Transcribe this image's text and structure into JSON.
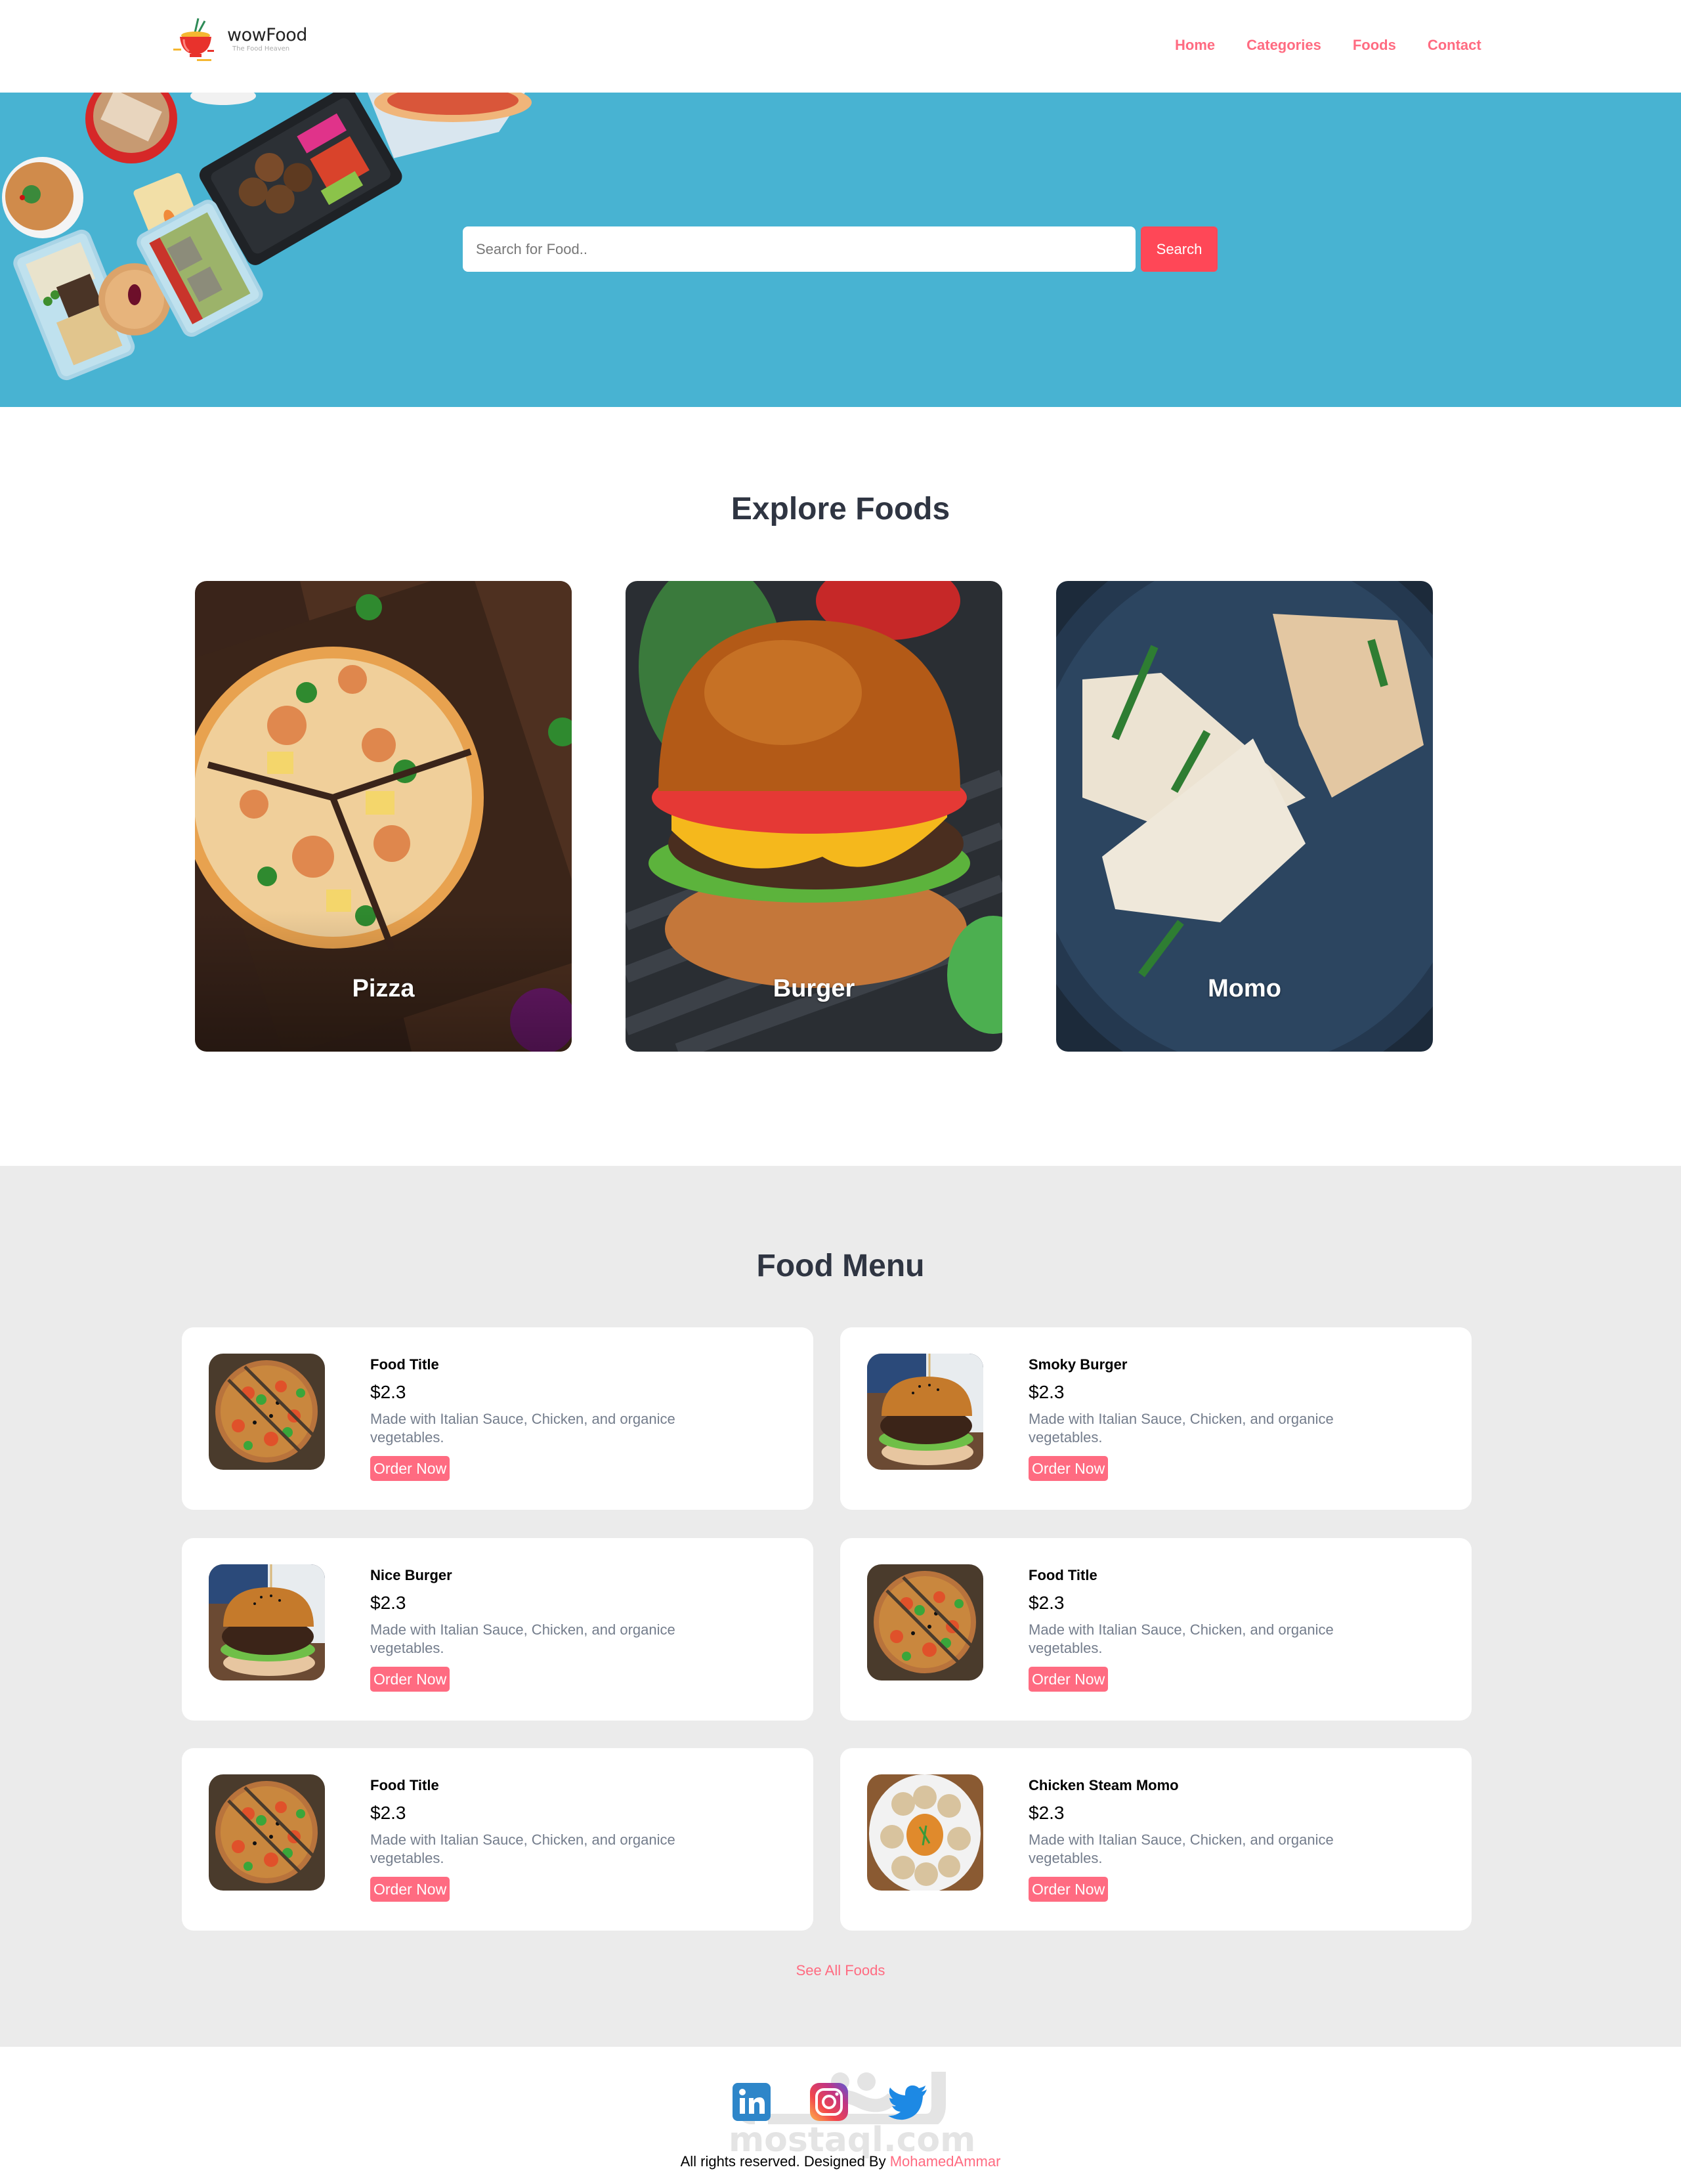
{
  "header": {
    "logo_name": "wowFood",
    "logo_tagline": "The Food Heaven",
    "nav": [
      {
        "label": "Home"
      },
      {
        "label": "Categories"
      },
      {
        "label": "Foods"
      },
      {
        "label": "Contact"
      }
    ]
  },
  "hero": {
    "search_placeholder": "Search for Food..",
    "search_value": "",
    "search_button": "Search"
  },
  "explore": {
    "title": "Explore Foods",
    "categories": [
      {
        "label": "Pizza",
        "image": "pizza-image"
      },
      {
        "label": "Burger",
        "image": "burger-image"
      },
      {
        "label": "Momo",
        "image": "momo-image"
      }
    ]
  },
  "menu": {
    "title": "Food Menu",
    "items": [
      {
        "title": "Food Title",
        "price": "$2.3",
        "description": "Made with Italian Sauce, Chicken, and organice vegetables.",
        "button": "Order Now",
        "image": "pizza"
      },
      {
        "title": "Smoky Burger",
        "price": "$2.3",
        "description": "Made with Italian Sauce, Chicken, and organice vegetables.",
        "button": "Order Now",
        "image": "burger"
      },
      {
        "title": "Nice Burger",
        "price": "$2.3",
        "description": "Made with Italian Sauce, Chicken, and organice vegetables.",
        "button": "Order Now",
        "image": "burger"
      },
      {
        "title": "Food Title",
        "price": "$2.3",
        "description": "Made with Italian Sauce, Chicken, and organice vegetables.",
        "button": "Order Now",
        "image": "pizza"
      },
      {
        "title": "Food Title",
        "price": "$2.3",
        "description": "Made with Italian Sauce, Chicken, and organice vegetables.",
        "button": "Order Now",
        "image": "pizza"
      },
      {
        "title": "Chicken Steam Momo",
        "price": "$2.3",
        "description": "Made with Italian Sauce, Chicken, and organice vegetables.",
        "button": "Order Now",
        "image": "momo"
      }
    ],
    "see_all": "See All Foods"
  },
  "footer": {
    "socials": [
      {
        "name": "linkedin-icon",
        "label": "in"
      },
      {
        "name": "instagram-icon"
      },
      {
        "name": "twitter-icon"
      }
    ],
    "watermark": "mostaql.com",
    "rights_text": "All rights reserved. Designed By ",
    "designer": "MohamedAmmar"
  },
  "colors": {
    "accent": "#ff6b81",
    "search_button": "#ff4757",
    "hero_bg": "#48b3d2",
    "menu_bg": "#ebebeb",
    "heading": "#2f3542",
    "muted_text": "#747d8c"
  }
}
